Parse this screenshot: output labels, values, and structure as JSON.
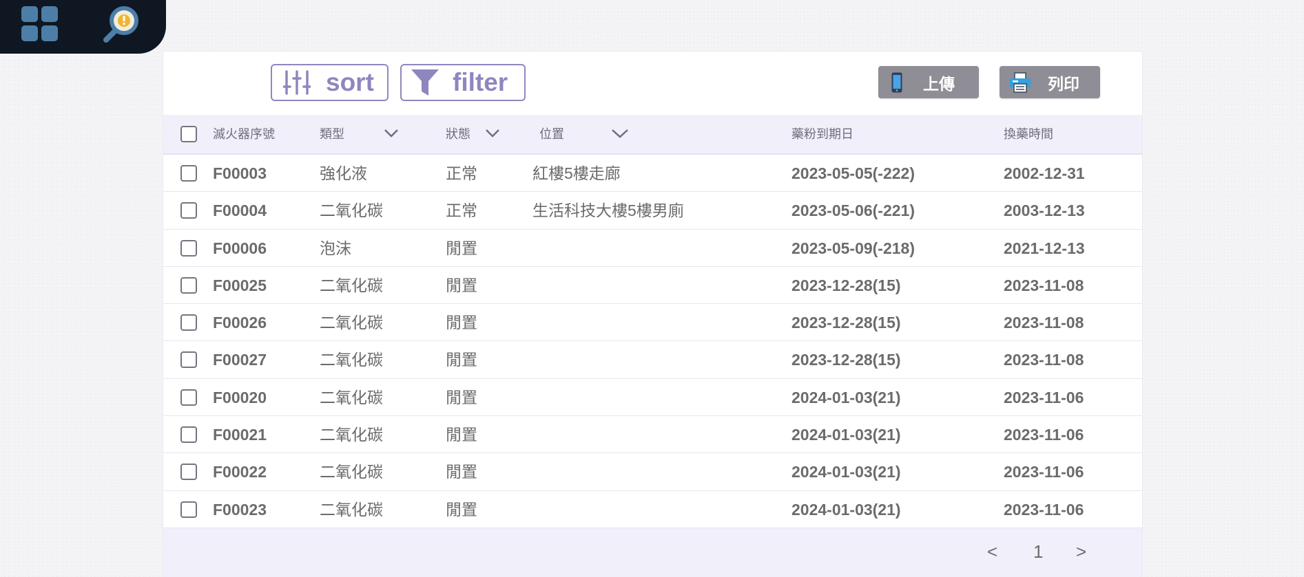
{
  "toolbar": {
    "sort_label": "sort",
    "filter_label": "filter",
    "upload_label": "上傳",
    "print_label": "列印"
  },
  "icons": {
    "nav_apps": "grid-icon",
    "nav_search": "search-alert-icon",
    "sort": "sliders-icon",
    "filter": "funnel-icon",
    "upload": "phone-icon",
    "print": "printer-icon"
  },
  "colors": {
    "accent": "#8e86bf",
    "header_bg": "#f1effa",
    "action_button": "#8f8d95",
    "nav_bg": "#0f1722",
    "nav_icon": "#4c7ea8"
  },
  "table": {
    "headers": {
      "serial": "滅火器序號",
      "type": "類型",
      "status": "狀態",
      "location": "位置",
      "expiry": "藥粉到期日",
      "refill": "換藥時間"
    },
    "rows": [
      {
        "serial": "F00003",
        "type": "強化液",
        "status": "正常",
        "location": "紅樓5樓走廊",
        "expiry": "2023-05-05(-222)",
        "refill": "2002-12-31"
      },
      {
        "serial": "F00004",
        "type": "二氧化碳",
        "status": "正常",
        "location": "生活科技大樓5樓男廁",
        "expiry": "2023-05-06(-221)",
        "refill": "2003-12-13"
      },
      {
        "serial": "F00006",
        "type": "泡沫",
        "status": "閒置",
        "location": "",
        "expiry": "2023-05-09(-218)",
        "refill": "2021-12-13"
      },
      {
        "serial": "F00025",
        "type": "二氧化碳",
        "status": "閒置",
        "location": "",
        "expiry": "2023-12-28(15)",
        "refill": "2023-11-08"
      },
      {
        "serial": "F00026",
        "type": "二氧化碳",
        "status": "閒置",
        "location": "",
        "expiry": "2023-12-28(15)",
        "refill": "2023-11-08"
      },
      {
        "serial": "F00027",
        "type": "二氧化碳",
        "status": "閒置",
        "location": "",
        "expiry": "2023-12-28(15)",
        "refill": "2023-11-08"
      },
      {
        "serial": "F00020",
        "type": "二氧化碳",
        "status": "閒置",
        "location": "",
        "expiry": "2024-01-03(21)",
        "refill": "2023-11-06"
      },
      {
        "serial": "F00021",
        "type": "二氧化碳",
        "status": "閒置",
        "location": "",
        "expiry": "2024-01-03(21)",
        "refill": "2023-11-06"
      },
      {
        "serial": "F00022",
        "type": "二氧化碳",
        "status": "閒置",
        "location": "",
        "expiry": "2024-01-03(21)",
        "refill": "2023-11-06"
      },
      {
        "serial": "F00023",
        "type": "二氧化碳",
        "status": "閒置",
        "location": "",
        "expiry": "2024-01-03(21)",
        "refill": "2023-11-06"
      }
    ]
  },
  "pagination": {
    "prev": "<",
    "page": "1",
    "next": ">"
  }
}
